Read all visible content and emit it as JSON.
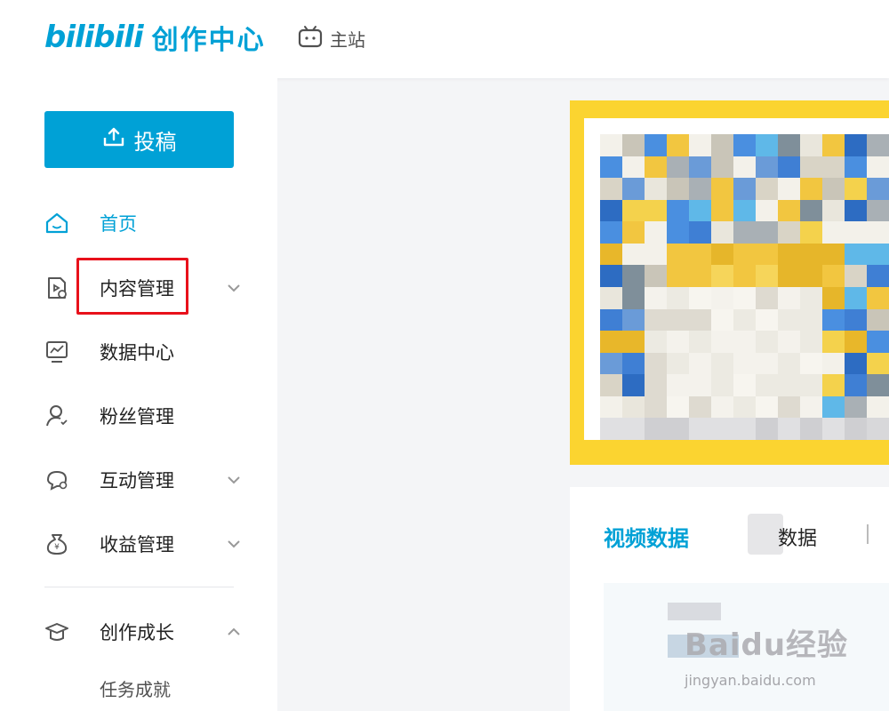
{
  "header": {
    "logo_brand": "bilibili",
    "logo_sub": "创作中心",
    "home_link": "主站"
  },
  "sidebar": {
    "upload_label": "投稿",
    "items": [
      {
        "label": "首页",
        "icon": "home-icon",
        "active": true
      },
      {
        "label": "内容管理",
        "icon": "content-icon",
        "chevron": "down"
      },
      {
        "label": "数据中心",
        "icon": "chart-icon"
      },
      {
        "label": "粉丝管理",
        "icon": "fans-icon"
      },
      {
        "label": "互动管理",
        "icon": "chat-icon",
        "chevron": "down"
      },
      {
        "label": "收益管理",
        "icon": "money-bag-icon",
        "chevron": "down"
      },
      {
        "label": "创作成长",
        "icon": "graduation-cap-icon",
        "chevron": "up"
      }
    ],
    "sub_item": "任务成就"
  },
  "main": {
    "card": {
      "tab_active": "视频数据",
      "tab_other_partial": "数据"
    }
  },
  "watermark": {
    "main": "Baidu经验",
    "url": "jingyan.baidu.com"
  },
  "colors": {
    "accent": "#00a1d6",
    "highlight": "#e8111b",
    "banner": "#fbd430"
  }
}
